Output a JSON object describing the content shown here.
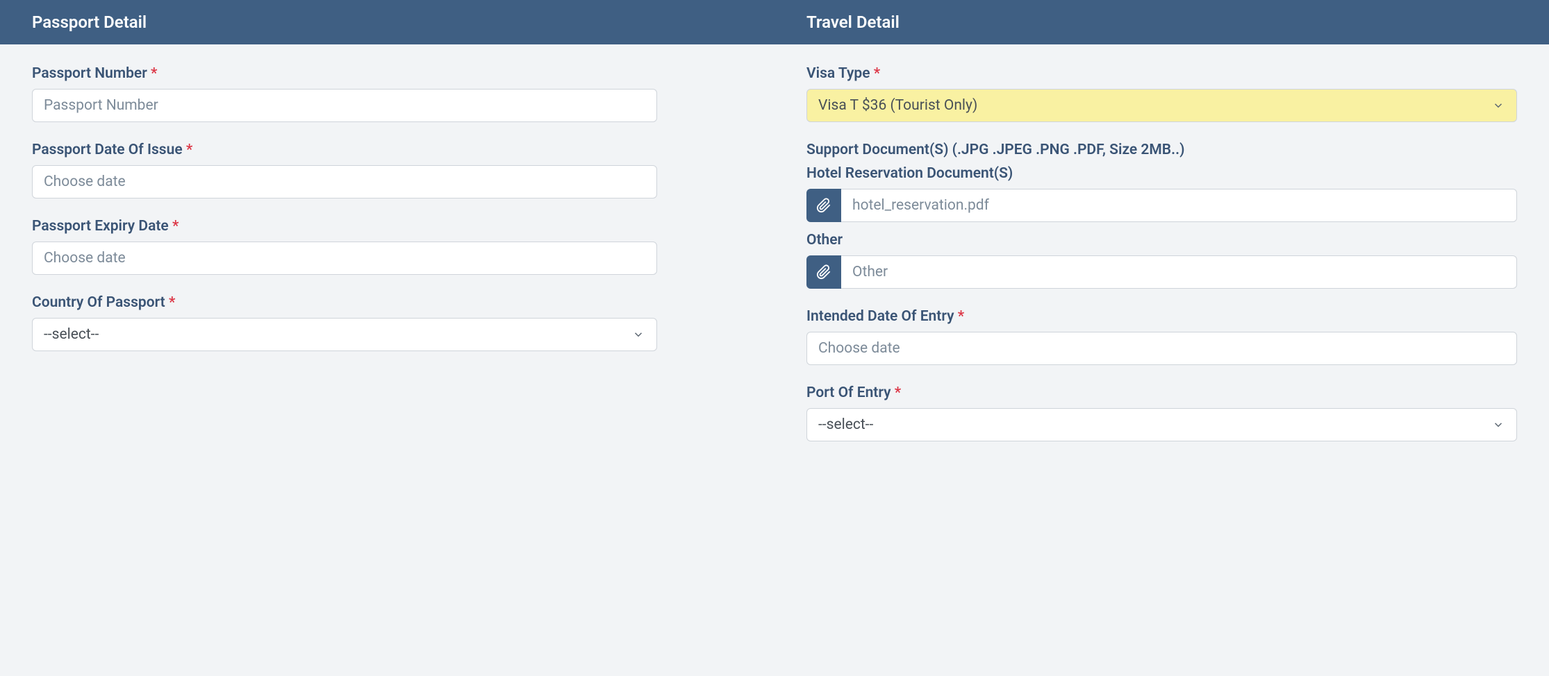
{
  "header": {
    "passport_title": "Passport Detail",
    "travel_title": "Travel Detail"
  },
  "passport": {
    "number_label": "Passport Number",
    "number_placeholder": "Passport Number",
    "number_value": "",
    "issue_date_label": "Passport Date Of Issue",
    "issue_date_placeholder": "Choose date",
    "issue_date_value": "",
    "expiry_date_label": "Passport Expiry Date",
    "expiry_date_placeholder": "Choose date",
    "expiry_date_value": "",
    "country_label": "Country Of Passport",
    "country_value": "--select--"
  },
  "travel": {
    "visa_type_label": "Visa Type",
    "visa_type_value": "Visa T $36 (Tourist Only)",
    "support_doc_label": "Support Document(S) (.JPG .JPEG .PNG .PDF, Size 2MB..)",
    "hotel_doc_label": "Hotel Reservation Document(S)",
    "hotel_doc_value": "hotel_reservation.pdf",
    "other_label": "Other",
    "other_placeholder": "Other",
    "other_value": "",
    "entry_date_label": "Intended Date Of Entry",
    "entry_date_placeholder": "Choose date",
    "entry_date_value": "",
    "port_label": "Port Of Entry",
    "port_value": "--select--"
  },
  "required_mark": "*"
}
